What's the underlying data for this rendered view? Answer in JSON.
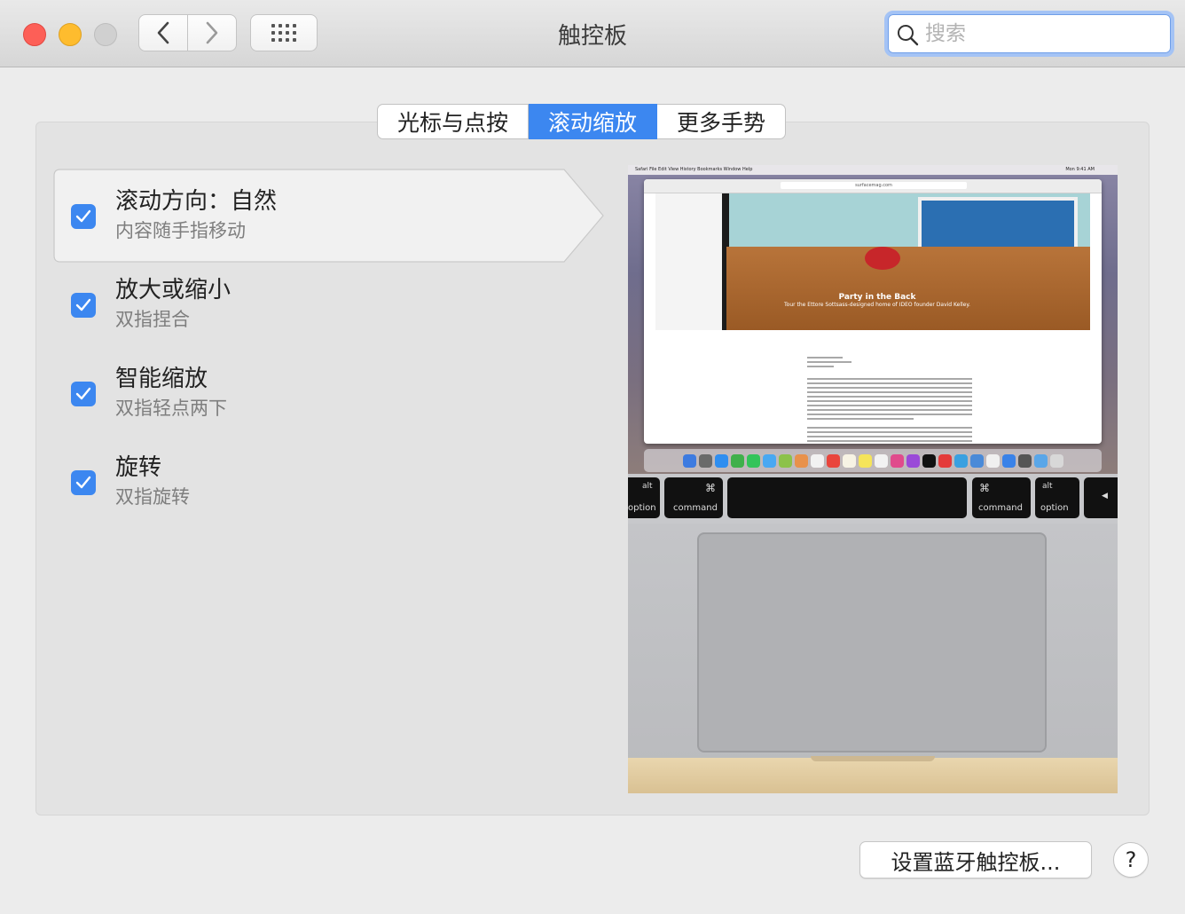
{
  "window": {
    "title": "触控板",
    "search": {
      "placeholder": "搜索",
      "value": ""
    }
  },
  "tabs": [
    {
      "label": "光标与点按",
      "selected": false
    },
    {
      "label": "滚动缩放",
      "selected": true
    },
    {
      "label": "更多手势",
      "selected": false
    }
  ],
  "options": [
    {
      "title": "滚动方向：自然",
      "subtitle": "内容随手指移动",
      "checked": true,
      "selected": true
    },
    {
      "title": "放大或缩小",
      "subtitle": "双指捏合",
      "checked": true,
      "selected": false
    },
    {
      "title": "智能缩放",
      "subtitle": "双指轻点两下",
      "checked": true,
      "selected": false
    },
    {
      "title": "旋转",
      "subtitle": "双指旋转",
      "checked": true,
      "selected": false
    }
  ],
  "preview": {
    "menubar": "Safari   File   Edit   View   History   Bookmarks   Window   Help",
    "clock": "Mon 9:41 AM",
    "url": "surfacemag.com",
    "article_title": "Party in the Back",
    "article_subtitle": "Tour the Ettore Sottsass-designed home of IDEO founder David Kelley.",
    "keys": {
      "left_alt_top": "alt",
      "left_alt_bottom": "option",
      "left_cmd_top": "⌘",
      "left_cmd_bottom": "command",
      "right_cmd_top": "⌘",
      "right_cmd_bottom": "command",
      "right_alt_top": "alt",
      "right_alt_bottom": "option",
      "arrow": "◀"
    }
  },
  "footer": {
    "bluetooth_button": "设置蓝牙触控板...",
    "help_button": "?"
  },
  "colors": {
    "accent": "#3c87f0",
    "close": "#fd5f57",
    "minimize": "#febc2e",
    "zoom_disabled": "#d0d0d0"
  }
}
